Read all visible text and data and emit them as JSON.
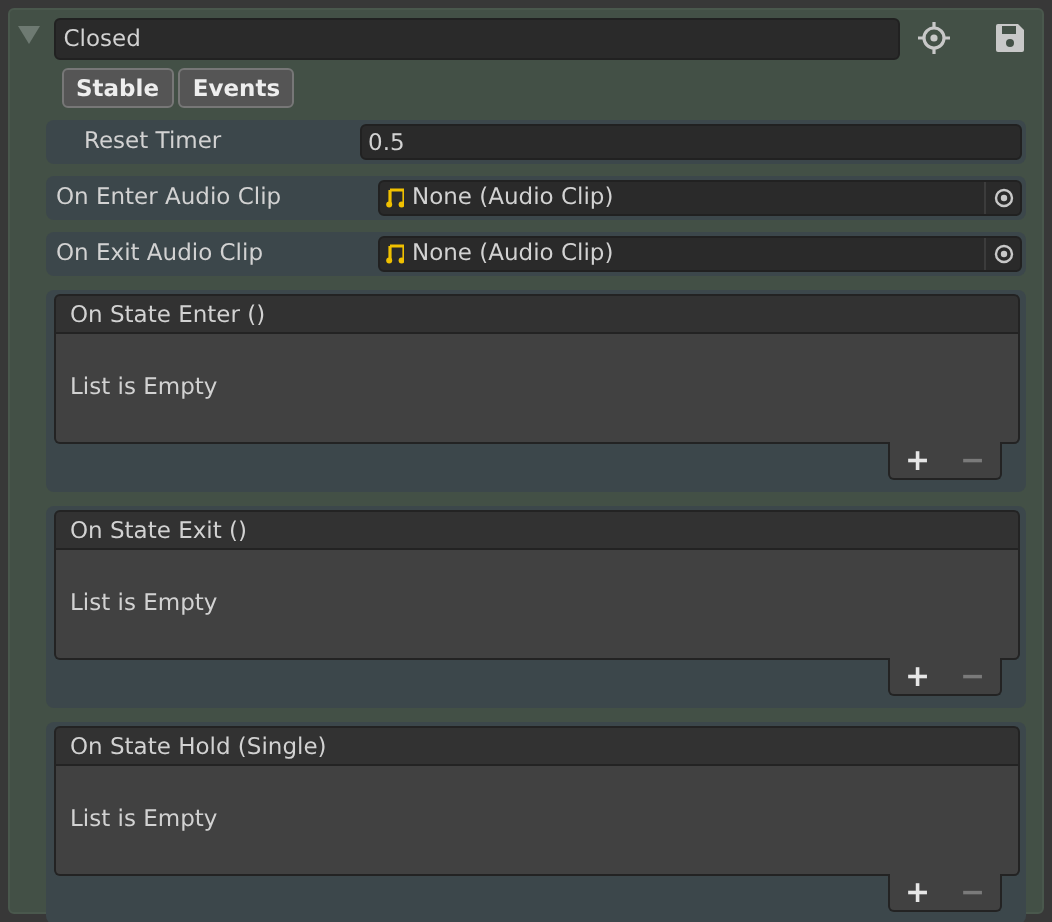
{
  "state": {
    "expanded": true,
    "name": "Closed"
  },
  "mode_buttons": [
    {
      "label": "Stable"
    },
    {
      "label": "Events"
    }
  ],
  "fields": [
    {
      "kind": "number",
      "label": "Reset Timer",
      "value": "0.5"
    },
    {
      "kind": "object",
      "label": "On Enter Audio Clip",
      "value": "None (Audio Clip)"
    },
    {
      "kind": "object",
      "label": "On Exit Audio Clip",
      "value": "None (Audio Clip)"
    }
  ],
  "events": [
    {
      "title": "On State Enter ()",
      "empty_text": "List is Empty",
      "add": "+",
      "remove": "−",
      "remove_disabled": true
    },
    {
      "title": "On State Exit ()",
      "empty_text": "List is Empty",
      "add": "+",
      "remove": "−",
      "remove_disabled": true
    },
    {
      "title": "On State Hold (Single)",
      "empty_text": "List is Empty",
      "add": "+",
      "remove": "−",
      "remove_disabled": true
    }
  ]
}
